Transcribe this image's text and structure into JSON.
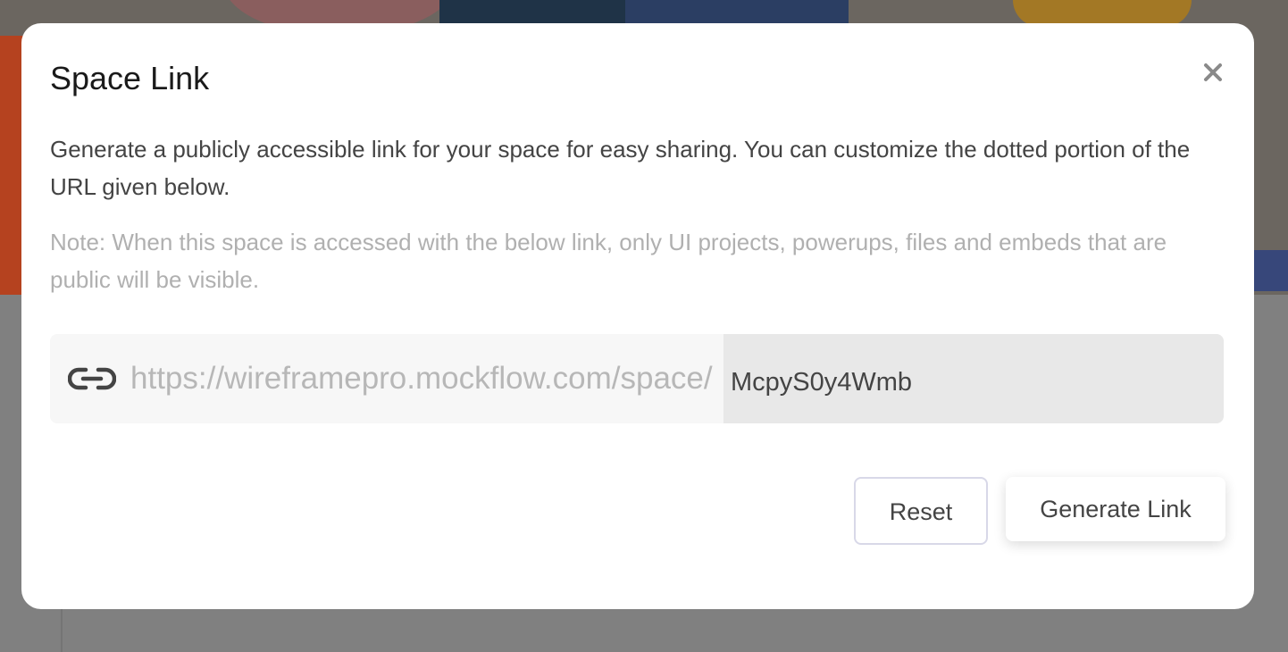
{
  "dialog": {
    "title": "Space Link",
    "close_icon": "close-icon",
    "description": "Generate a publicly accessible link for your space for easy sharing. You can customize the dotted portion of the URL given below.",
    "note": "Note: When this space is accessed with the below link, only UI projects, powerups, files and embeds that are public will be visible.",
    "link": {
      "icon": "link-icon",
      "url_prefix": "https://wireframepro.mockflow.com/space/",
      "slug_value": "McpyS0y4Wmb"
    },
    "buttons": {
      "reset_label": "Reset",
      "generate_label": "Generate Link"
    }
  },
  "colors": {
    "dialog_background": "#ffffff",
    "backdrop": "#7d7d7d",
    "description_text": "#444444",
    "note_text": "#b0b0b0",
    "slug_field_background": "#e8e8e8"
  }
}
